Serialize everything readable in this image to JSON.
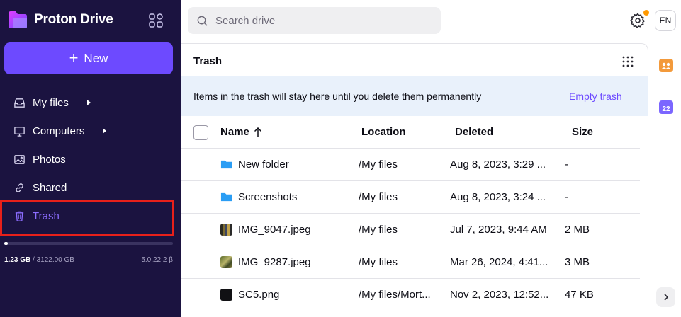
{
  "app": {
    "brand": "Proton Drive"
  },
  "sidebar": {
    "new_label": "New",
    "items": [
      {
        "label": "My files",
        "icon": "inbox-icon"
      },
      {
        "label": "Computers",
        "icon": "monitor-icon"
      },
      {
        "label": "Photos",
        "icon": "image-icon"
      },
      {
        "label": "Shared",
        "icon": "link-icon"
      },
      {
        "label": "Trash",
        "icon": "trash-icon"
      }
    ],
    "storage": {
      "used": "1.23 GB",
      "total": " / 3122.00 GB",
      "used_fraction": 0.0004
    },
    "version": "5.0.22.2 β"
  },
  "topbar": {
    "search_placeholder": "Search drive",
    "language": "EN"
  },
  "main": {
    "title": "Trash",
    "banner_text": "Items in the trash will stay here until you delete them permanently",
    "empty_trash_label": "Empty trash",
    "columns": {
      "name": "Name",
      "location": "Location",
      "deleted": "Deleted",
      "size": "Size"
    },
    "rows": [
      {
        "name": "New folder",
        "location": "/My files",
        "deleted": "Aug 8, 2023, 3:29 ...",
        "size": "-",
        "icon": "folder-icon"
      },
      {
        "name": "Screenshots",
        "location": "/My files",
        "deleted": "Aug 8, 2023, 3:24 ...",
        "size": "-",
        "icon": "folder-icon"
      },
      {
        "name": "IMG_9047.jpeg",
        "location": "/My files",
        "deleted": "Jul 7, 2023, 9:44 AM",
        "size": "2 MB",
        "icon": "image-thumbnail"
      },
      {
        "name": "IMG_9287.jpeg",
        "location": "/My files",
        "deleted": "Mar 26, 2024, 4:41...",
        "size": "3 MB",
        "icon": "image-thumbnail"
      },
      {
        "name": "SC5.png",
        "location": "/My files/Mort...",
        "deleted": "Nov 2, 2023, 12:52...",
        "size": "47 KB",
        "icon": "image-thumbnail"
      }
    ]
  },
  "rail": {
    "calendar_day": "22"
  },
  "colors": {
    "sidebar_bg": "#1b1340",
    "accent": "#6d4aff",
    "banner_bg": "#e9f1fb",
    "highlight": "#e8201a"
  }
}
